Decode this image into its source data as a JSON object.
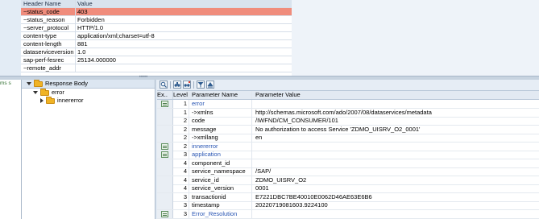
{
  "header_table": {
    "columns": [
      "Header Name",
      "Value"
    ],
    "rows": [
      {
        "name": "~status_code",
        "value": "403"
      },
      {
        "name": "~status_reason",
        "value": "Forbidden"
      },
      {
        "name": "~server_protocol",
        "value": "HTTP/1.0"
      },
      {
        "name": "content-type",
        "value": "application/xml;charset=utf-8"
      },
      {
        "name": "content-length",
        "value": "881"
      },
      {
        "name": "dataserviceversion",
        "value": "1.0"
      },
      {
        "name": "sap-perf-fesrec",
        "value": "25134.000000"
      },
      {
        "name": "~remote_addr",
        "value": ""
      }
    ]
  },
  "left_strip": {
    "text": "ms s"
  },
  "tree": {
    "root": "Response Body",
    "child": "error",
    "grandchild": "innererror"
  },
  "grid": {
    "columns": {
      "ex": "Ex..",
      "level": "Level",
      "name": "Parameter Name",
      "value": "Parameter Value"
    },
    "rows": [
      {
        "level": "1",
        "name": "error",
        "value": "",
        "blue": true,
        "expandable": true
      },
      {
        "level": "1",
        "name": "->xmlns",
        "value": "http://schemas.microsoft.com/ado/2007/08/dataservices/metadata",
        "blue": false,
        "expandable": false
      },
      {
        "level": "2",
        "name": "code",
        "value": "/IWFND/CM_CONSUMER/101",
        "blue": false,
        "expandable": false
      },
      {
        "level": "2",
        "name": "message",
        "value": "No authorization to access Service 'ZDMO_UISRV_O2_0001'",
        "blue": false,
        "expandable": false
      },
      {
        "level": "2",
        "name": "->xmllang",
        "value": "en",
        "blue": false,
        "expandable": false
      },
      {
        "level": "2",
        "name": "innererror",
        "value": "",
        "blue": true,
        "expandable": true
      },
      {
        "level": "3",
        "name": "application",
        "value": "",
        "blue": true,
        "expandable": true
      },
      {
        "level": "4",
        "name": "component_id",
        "value": "",
        "blue": false,
        "expandable": false
      },
      {
        "level": "4",
        "name": "service_namespace",
        "value": "/SAP/",
        "blue": false,
        "expandable": false
      },
      {
        "level": "4",
        "name": "service_id",
        "value": "ZDMO_UISRV_O2",
        "blue": false,
        "expandable": false
      },
      {
        "level": "4",
        "name": "service_version",
        "value": "0001",
        "blue": false,
        "expandable": false
      },
      {
        "level": "3",
        "name": "transactionid",
        "value": "E7221DBC7BE40010E0062D46AE63E6B6",
        "blue": false,
        "expandable": false
      },
      {
        "level": "3",
        "name": "timestamp",
        "value": "20220719081603.9224100",
        "blue": false,
        "expandable": false
      },
      {
        "level": "3",
        "name": "Error_Resolution",
        "value": "",
        "blue": true,
        "expandable": true
      }
    ]
  }
}
